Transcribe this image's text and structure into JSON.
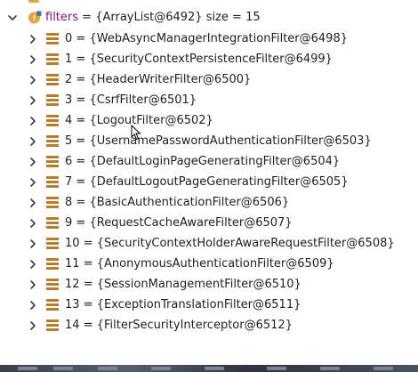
{
  "parent": {
    "name": "filters",
    "equals": "=",
    "value": "{ArrayList@6492}",
    "size_text": "size = 15"
  },
  "items": [
    {
      "index": "0",
      "value": "{WebAsyncManagerIntegrationFilter@6498}"
    },
    {
      "index": "1",
      "value": "{SecurityContextPersistenceFilter@6499}"
    },
    {
      "index": "2",
      "value": "{HeaderWriterFilter@6500}"
    },
    {
      "index": "3",
      "value": "{CsrfFilter@6501}"
    },
    {
      "index": "4",
      "value": "{LogoutFilter@6502}"
    },
    {
      "index": "5",
      "value": "{UsernamePasswordAuthenticationFilter@6503}"
    },
    {
      "index": "6",
      "value": "{DefaultLoginPageGeneratingFilter@6504}"
    },
    {
      "index": "7",
      "value": "{DefaultLogoutPageGeneratingFilter@6505}"
    },
    {
      "index": "8",
      "value": "{BasicAuthenticationFilter@6506}"
    },
    {
      "index": "9",
      "value": "{RequestCacheAwareFilter@6507}"
    },
    {
      "index": "10",
      "value": "{SecurityContextHolderAwareRequestFilter@6508}"
    },
    {
      "index": "11",
      "value": "{AnonymousAuthenticationFilter@6509}"
    },
    {
      "index": "12",
      "value": "{SessionManagementFilter@6510}"
    },
    {
      "index": "13",
      "value": "{ExceptionTranslationFilter@6511}"
    },
    {
      "index": "14",
      "value": "{FilterSecurityInterceptor@6512}"
    }
  ],
  "icons": {
    "parent_toggle": "chevron-down-icon",
    "child_toggle": "chevron-right-icon",
    "field": "field-icon",
    "list_item": "list-item-icon"
  },
  "colors": {
    "field_icon": "#e8a33d",
    "field_icon_badge": "#3a71c1",
    "list_icon": "#b57d2d",
    "field_name": "#871094"
  }
}
